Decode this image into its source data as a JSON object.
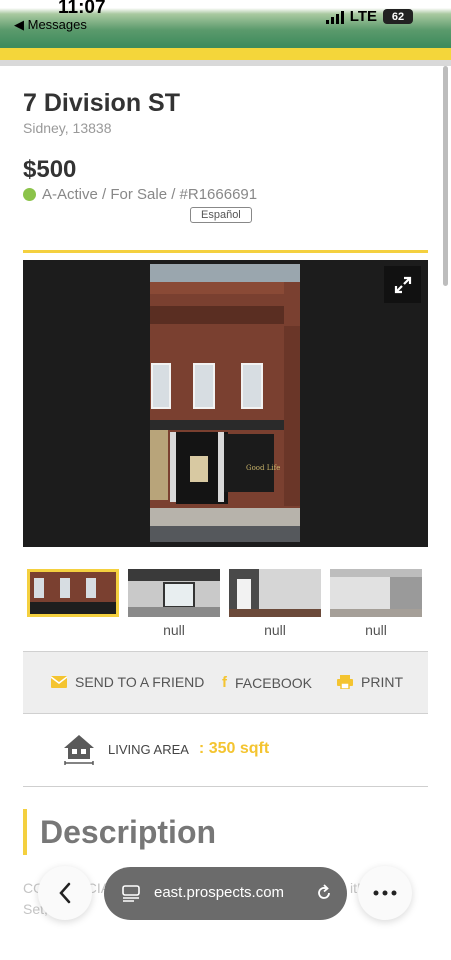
{
  "status_bar": {
    "time": "11:07",
    "back_label": "◀ Messages",
    "network": "LTE",
    "battery": "62"
  },
  "listing": {
    "address": "7 Division ST",
    "locality": "Sidney, 13838",
    "price": "$500",
    "status": "A-Active / For Sale / #R1666691",
    "language_button": "Español"
  },
  "thumbnails": [
    {
      "label": ""
    },
    {
      "label": "null"
    },
    {
      "label": "null"
    },
    {
      "label": "null"
    }
  ],
  "share": {
    "send_label": "SEND TO A FRIEND",
    "facebook_label": "FACEBOOK",
    "print_label": "PRINT"
  },
  "details": {
    "living_area_label": "LIVING AREA",
    "living_area_value": ": 350 sqft"
  },
  "description": {
    "title": "Description",
    "text": "COMMERCIAL ... business ... Excited for you to see it! Ready, Set, Go!"
  },
  "browser": {
    "url": "east.prospects.com"
  },
  "colors": {
    "accent_yellow": "#f4d03f",
    "status_green": "#8bc34a",
    "header_green": "#3f8c5d"
  }
}
